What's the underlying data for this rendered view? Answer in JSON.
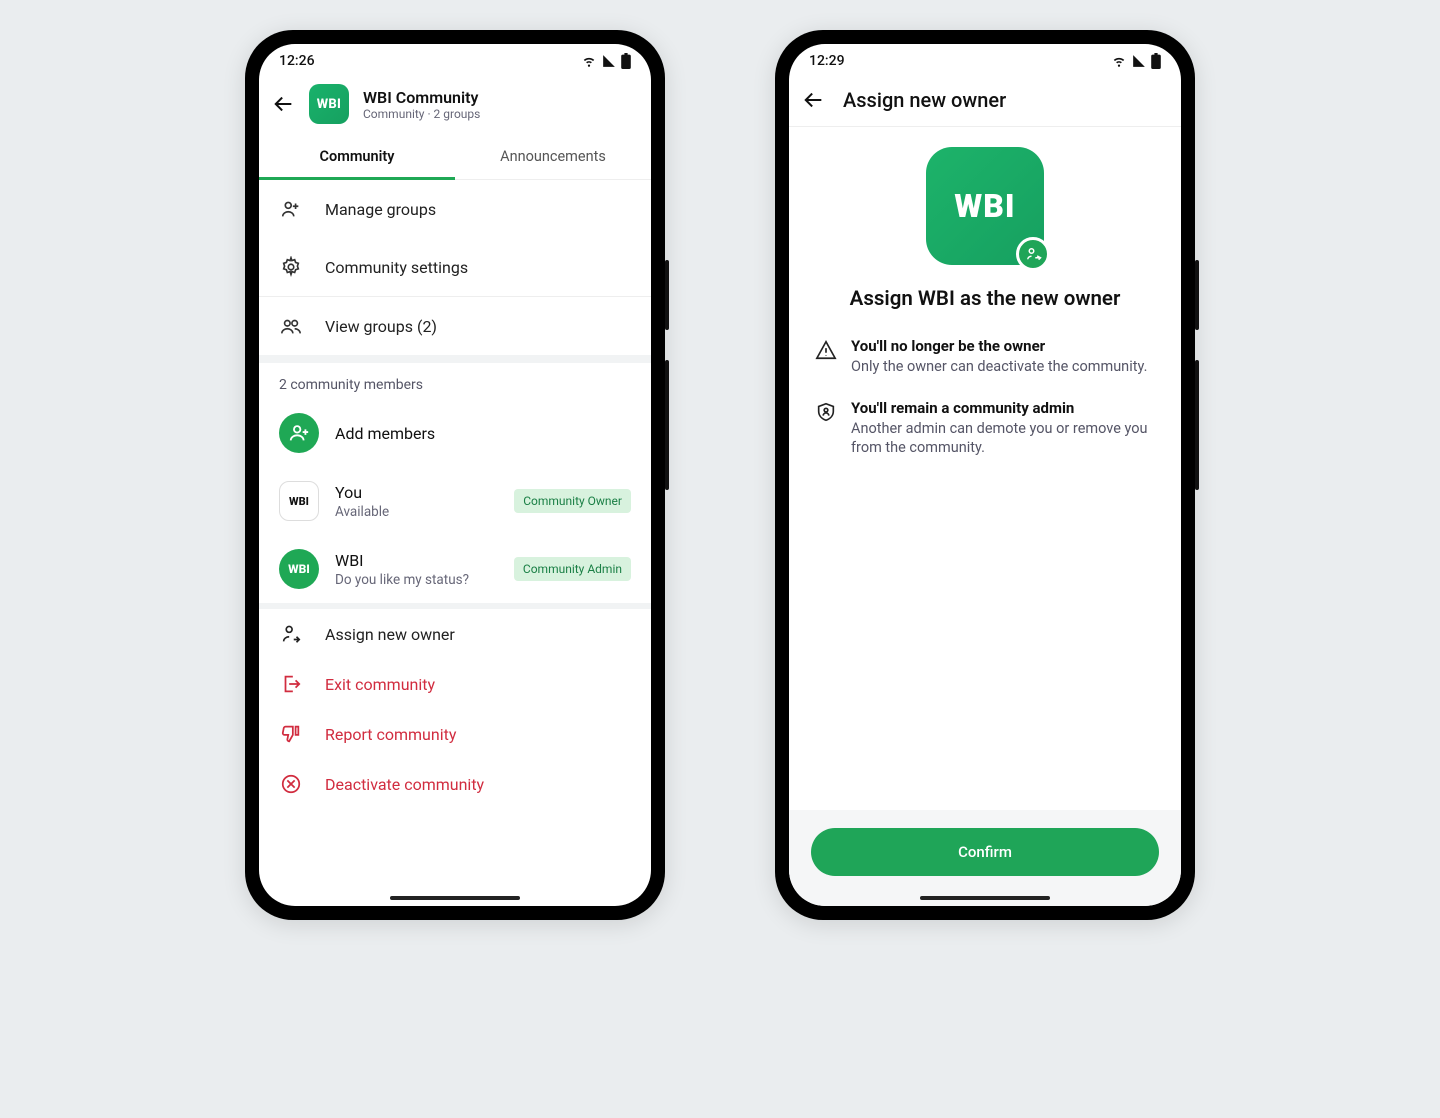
{
  "left": {
    "time": "12:26",
    "header": {
      "title": "WBI Community",
      "subtitle": "Community · 2 groups",
      "icon_label": "WBI"
    },
    "tabs": {
      "community": "Community",
      "announcements": "Announcements"
    },
    "actions": {
      "manage": "Manage groups",
      "settings": "Community settings",
      "view": "View groups (2)"
    },
    "members_head": "2 community members",
    "add_members": "Add members",
    "members": [
      {
        "name": "You",
        "status": "Available",
        "badge": "Community Owner",
        "avatar": "WBI"
      },
      {
        "name": "WBI",
        "status": "Do you like my status?",
        "badge": "Community Admin",
        "avatar": "WBI"
      }
    ],
    "bottom": {
      "assign": "Assign new owner",
      "exit": "Exit community",
      "report": "Report community",
      "deactivate": "Deactivate community"
    }
  },
  "right": {
    "time": "12:29",
    "title": "Assign new owner",
    "icon_label": "WBI",
    "headline": "Assign WBI as the new owner",
    "info1_title": "You'll no longer be the owner",
    "info1_body": "Only the owner can deactivate the community.",
    "info2_title": "You'll remain a community admin",
    "info2_body": "Another admin can demote you or remove you from the community.",
    "confirm": "Confirm"
  }
}
